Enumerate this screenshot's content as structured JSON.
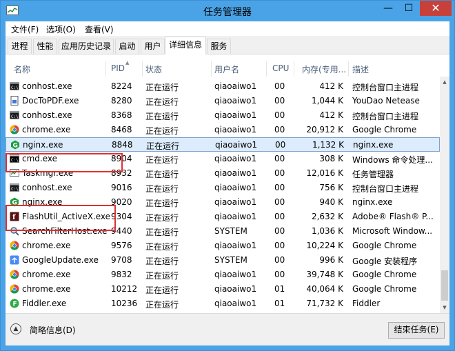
{
  "window": {
    "title": "任务管理器",
    "close_glyph": "✕",
    "maximize_glyph": "☐",
    "minimize_glyph": "—"
  },
  "menu": [
    "文件(F)",
    "选项(O)",
    "查看(V)"
  ],
  "tabs": [
    "进程",
    "性能",
    "应用历史记录",
    "启动",
    "用户",
    "详细信息",
    "服务"
  ],
  "active_tab": "详细信息",
  "columns": {
    "name": "名称",
    "pid": "PID",
    "status": "状态",
    "user": "用户名",
    "cpu": "CPU",
    "mem": "内存(专用...",
    "desc": "描述"
  },
  "rows": [
    {
      "name": "conhost.exe",
      "pid": "8224",
      "status": "正在运行",
      "user": "qiaoaiwo1",
      "cpu": "00",
      "mem": "412 K",
      "desc": "控制台窗口主进程",
      "icon": "console-icon"
    },
    {
      "name": "DocToPDF.exe",
      "pid": "8280",
      "status": "正在运行",
      "user": "qiaoaiwo1",
      "cpu": "00",
      "mem": "1,044 K",
      "desc": "YouDao Netease",
      "icon": "doc-to-pdf-icon"
    },
    {
      "name": "conhost.exe",
      "pid": "8368",
      "status": "正在运行",
      "user": "qiaoaiwo1",
      "cpu": "00",
      "mem": "412 K",
      "desc": "控制台窗口主进程",
      "icon": "console-icon"
    },
    {
      "name": "chrome.exe",
      "pid": "8468",
      "status": "正在运行",
      "user": "qiaoaiwo1",
      "cpu": "00",
      "mem": "20,912 K",
      "desc": "Google Chrome",
      "icon": "chrome-icon"
    },
    {
      "name": "nginx.exe",
      "pid": "8848",
      "status": "正在运行",
      "user": "qiaoaiwo1",
      "cpu": "00",
      "mem": "1,132 K",
      "desc": "nginx.exe",
      "icon": "nginx-icon",
      "selected": true
    },
    {
      "name": "cmd.exe",
      "pid": "8904",
      "status": "正在运行",
      "user": "qiaoaiwo1",
      "cpu": "00",
      "mem": "308 K",
      "desc": "Windows 命令处理...",
      "icon": "cmd-icon"
    },
    {
      "name": "Taskmgr.exe",
      "pid": "8932",
      "status": "正在运行",
      "user": "qiaoaiwo1",
      "cpu": "00",
      "mem": "12,016 K",
      "desc": "任务管理器",
      "icon": "taskmgr-icon"
    },
    {
      "name": "conhost.exe",
      "pid": "9016",
      "status": "正在运行",
      "user": "qiaoaiwo1",
      "cpu": "00",
      "mem": "756 K",
      "desc": "控制台窗口主进程",
      "icon": "console-icon"
    },
    {
      "name": "nginx.exe",
      "pid": "9020",
      "status": "正在运行",
      "user": "qiaoaiwo1",
      "cpu": "00",
      "mem": "940 K",
      "desc": "nginx.exe",
      "icon": "nginx-icon"
    },
    {
      "name": "FlashUtil_ActiveX.exe",
      "pid": "9304",
      "status": "正在运行",
      "user": "qiaoaiwo1",
      "cpu": "00",
      "mem": "2,632 K",
      "desc": "Adobe® Flash® P...",
      "icon": "flash-icon"
    },
    {
      "name": "SearchFilterHost.exe",
      "pid": "9440",
      "status": "正在运行",
      "user": "SYSTEM",
      "cpu": "00",
      "mem": "1,036 K",
      "desc": "Microsoft Window...",
      "icon": "search-filter-icon"
    },
    {
      "name": "chrome.exe",
      "pid": "9576",
      "status": "正在运行",
      "user": "qiaoaiwo1",
      "cpu": "00",
      "mem": "10,224 K",
      "desc": "Google Chrome",
      "icon": "chrome-icon"
    },
    {
      "name": "GoogleUpdate.exe",
      "pid": "9708",
      "status": "正在运行",
      "user": "SYSTEM",
      "cpu": "00",
      "mem": "996 K",
      "desc": "Google 安装程序",
      "icon": "google-update-icon"
    },
    {
      "name": "chrome.exe",
      "pid": "9832",
      "status": "正在运行",
      "user": "qiaoaiwo1",
      "cpu": "00",
      "mem": "39,748 K",
      "desc": "Google Chrome",
      "icon": "chrome-icon"
    },
    {
      "name": "chrome.exe",
      "pid": "10212",
      "status": "正在运行",
      "user": "qiaoaiwo1",
      "cpu": "01",
      "mem": "40,064 K",
      "desc": "Google Chrome",
      "icon": "chrome-icon"
    },
    {
      "name": "Fiddler.exe",
      "pid": "10236",
      "status": "正在运行",
      "user": "qiaoaiwo1",
      "cpu": "01",
      "mem": "71,732 K",
      "desc": "Fiddler",
      "icon": "fiddler-icon"
    }
  ],
  "footer": {
    "fewer_details": "简略信息(D)",
    "end_task": "结束任务(E)"
  },
  "colors": {
    "titlebar": "#4aa3e6",
    "close_button": "#c7403a",
    "selection": "#dcecfc",
    "annotation": "#e03030"
  }
}
